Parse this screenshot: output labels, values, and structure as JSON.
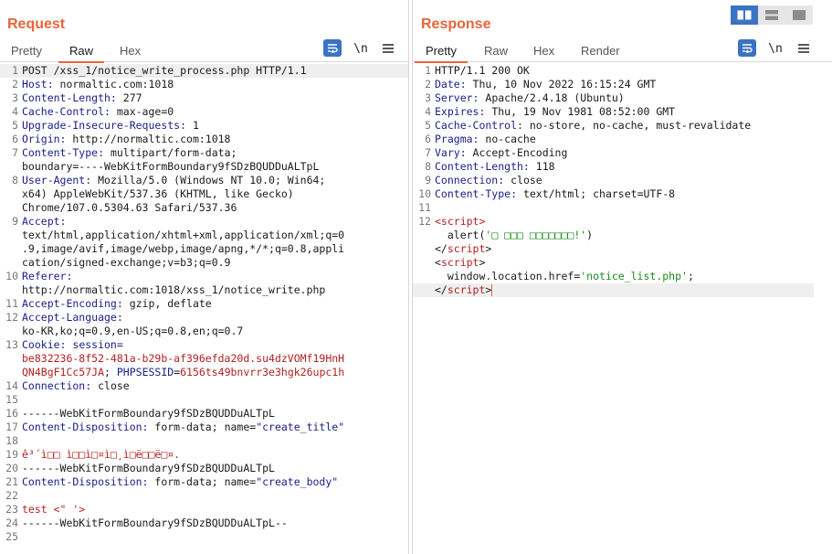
{
  "request": {
    "title": "Request",
    "tabs": [
      "Pretty",
      "Raw",
      "Hex"
    ],
    "active_tab": "Raw",
    "toolbar": {
      "wrap_icon": "wrap-lines-icon",
      "newline_label": "\\n",
      "menu_icon": "hamburger-menu-icon"
    },
    "lines": [
      {
        "n": "1",
        "parts": [
          {
            "t": "POST /xss_1/notice_write_process.php HTTP/1.1"
          }
        ],
        "cur": true
      },
      {
        "n": "2",
        "parts": [
          {
            "t": "Host:",
            "c": "hk"
          },
          {
            "t": " normaltic.com:1018"
          }
        ]
      },
      {
        "n": "3",
        "parts": [
          {
            "t": "Content-Length:",
            "c": "hk"
          },
          {
            "t": " 277"
          }
        ]
      },
      {
        "n": "4",
        "parts": [
          {
            "t": "Cache-Control:",
            "c": "hk"
          },
          {
            "t": " max-age=0"
          }
        ]
      },
      {
        "n": "5",
        "parts": [
          {
            "t": "Upgrade-Insecure-Requests:",
            "c": "hk"
          },
          {
            "t": " 1"
          }
        ]
      },
      {
        "n": "6",
        "parts": [
          {
            "t": "Origin:",
            "c": "hk"
          },
          {
            "t": " http://normaltic.com:1018"
          }
        ]
      },
      {
        "n": "7",
        "parts": [
          {
            "t": "Content-Type:",
            "c": "hk"
          },
          {
            "t": " multipart/form-data;"
          }
        ]
      },
      {
        "n": "",
        "parts": [
          {
            "t": "boundary=----WebKitFormBoundary9fSDzBQUDDuALTpL"
          }
        ]
      },
      {
        "n": "8",
        "parts": [
          {
            "t": "User-Agent:",
            "c": "hk"
          },
          {
            "t": " Mozilla/5.0 (Windows NT 10.0; Win64;"
          }
        ]
      },
      {
        "n": "",
        "parts": [
          {
            "t": "x64) AppleWebKit/537.36 (KHTML, like Gecko)"
          }
        ]
      },
      {
        "n": "",
        "parts": [
          {
            "t": "Chrome/107.0.5304.63 Safari/537.36"
          }
        ]
      },
      {
        "n": "9",
        "parts": [
          {
            "t": "Accept:",
            "c": "hk"
          }
        ]
      },
      {
        "n": "",
        "parts": [
          {
            "t": "text/html,application/xhtml+xml,application/xml;q=0"
          }
        ]
      },
      {
        "n": "",
        "parts": [
          {
            "t": ".9,image/avif,image/webp,image/apng,*/*;q=0.8,appli"
          }
        ]
      },
      {
        "n": "",
        "parts": [
          {
            "t": "cation/signed-exchange;v=b3;q=0.9"
          }
        ]
      },
      {
        "n": "10",
        "parts": [
          {
            "t": "Referer:",
            "c": "hk"
          }
        ]
      },
      {
        "n": "",
        "parts": [
          {
            "t": "http://normaltic.com:1018/xss_1/notice_write.php"
          }
        ]
      },
      {
        "n": "11",
        "parts": [
          {
            "t": "Accept-Encoding:",
            "c": "hk"
          },
          {
            "t": " gzip, deflate"
          }
        ]
      },
      {
        "n": "12",
        "parts": [
          {
            "t": "Accept-Language:",
            "c": "hk"
          }
        ]
      },
      {
        "n": "",
        "parts": [
          {
            "t": "ko-KR,ko;q=0.9,en-US;q=0.8,en;q=0.7"
          }
        ]
      },
      {
        "n": "13",
        "parts": [
          {
            "t": "Cookie:",
            "c": "hk"
          },
          {
            "t": " session=",
            "c": "hk"
          }
        ]
      },
      {
        "n": "",
        "parts": [
          {
            "t": "be832236-8f52-481a-b29b-af396efda20d.su4dzVOMf19HnH",
            "c": "red"
          }
        ]
      },
      {
        "n": "",
        "parts": [
          {
            "t": "QN4BgF1Cc57JA",
            "c": "red"
          },
          {
            "t": "; "
          },
          {
            "t": "PHPSESSID",
            "c": "hk"
          },
          {
            "t": "="
          },
          {
            "t": "6156ts49bnvrr3e3hgk26upc1h",
            "c": "red"
          }
        ]
      },
      {
        "n": "14",
        "parts": [
          {
            "t": "Connection:",
            "c": "hk"
          },
          {
            "t": " close"
          }
        ]
      },
      {
        "n": "15",
        "parts": [
          {
            "t": ""
          }
        ]
      },
      {
        "n": "16",
        "parts": [
          {
            "t": "------WebKitFormBoundary9fSDzBQUDDuALTpL"
          }
        ]
      },
      {
        "n": "17",
        "parts": [
          {
            "t": "Content-Disposition:",
            "c": "hk"
          },
          {
            "t": " form-data; name="
          },
          {
            "t": "\"create_title\"",
            "c": "hk"
          }
        ]
      },
      {
        "n": "18",
        "parts": [
          {
            "t": ""
          }
        ]
      },
      {
        "n": "19",
        "parts": [
          {
            "t": "ê³´ì□□ ì□□ì□¤ì□¸ì□ë□□ë□¤.",
            "c": "red"
          }
        ]
      },
      {
        "n": "20",
        "parts": [
          {
            "t": "------WebKitFormBoundary9fSDzBQUDDuALTpL"
          }
        ]
      },
      {
        "n": "21",
        "parts": [
          {
            "t": "Content-Disposition:",
            "c": "hk"
          },
          {
            "t": " form-data; name="
          },
          {
            "t": "\"create_body\"",
            "c": "hk"
          }
        ]
      },
      {
        "n": "22",
        "parts": [
          {
            "t": ""
          }
        ]
      },
      {
        "n": "23",
        "parts": [
          {
            "t": "test <\" '>",
            "c": "red"
          }
        ]
      },
      {
        "n": "24",
        "parts": [
          {
            "t": "------WebKitFormBoundary9fSDzBQUDDuALTpL--"
          }
        ]
      },
      {
        "n": "25",
        "parts": [
          {
            "t": ""
          }
        ]
      }
    ]
  },
  "response": {
    "title": "Response",
    "tabs": [
      "Pretty",
      "Raw",
      "Hex",
      "Render"
    ],
    "active_tab": "Pretty",
    "toolbar": {
      "wrap_icon": "wrap-lines-icon",
      "newline_label": "\\n",
      "menu_icon": "hamburger-menu-icon"
    },
    "lines": [
      {
        "n": "1",
        "parts": [
          {
            "t": "HTTP/1.1 200 OK"
          }
        ]
      },
      {
        "n": "2",
        "parts": [
          {
            "t": "Date:",
            "c": "hk"
          },
          {
            "t": " Thu, 10 Nov 2022 16:15:24 GMT"
          }
        ]
      },
      {
        "n": "3",
        "parts": [
          {
            "t": "Server:",
            "c": "hk"
          },
          {
            "t": " Apache/2.4.18 (Ubuntu)"
          }
        ]
      },
      {
        "n": "4",
        "parts": [
          {
            "t": "Expires:",
            "c": "hk"
          },
          {
            "t": " Thu, 19 Nov 1981 08:52:00 GMT"
          }
        ]
      },
      {
        "n": "5",
        "parts": [
          {
            "t": "Cache-Control:",
            "c": "hk"
          },
          {
            "t": " no-store, no-cache, must-revalidate"
          }
        ]
      },
      {
        "n": "6",
        "parts": [
          {
            "t": "Pragma:",
            "c": "hk"
          },
          {
            "t": " no-cache"
          }
        ]
      },
      {
        "n": "7",
        "parts": [
          {
            "t": "Vary:",
            "c": "hk"
          },
          {
            "t": " Accept-Encoding"
          }
        ]
      },
      {
        "n": "8",
        "parts": [
          {
            "t": "Content-Length:",
            "c": "hk"
          },
          {
            "t": " 118"
          }
        ]
      },
      {
        "n": "9",
        "parts": [
          {
            "t": "Connection:",
            "c": "hk"
          },
          {
            "t": " close"
          }
        ]
      },
      {
        "n": "10",
        "parts": [
          {
            "t": "Content-Type:",
            "c": "hk"
          },
          {
            "t": " text/html; charset=UTF-8"
          }
        ]
      },
      {
        "n": "11",
        "parts": [
          {
            "t": ""
          }
        ]
      },
      {
        "n": "12",
        "parts": [
          {
            "t": "<script>",
            "c": "tag"
          }
        ]
      },
      {
        "n": "",
        "parts": [
          {
            "t": "  alert("
          },
          {
            "t": "'□ □□□ □□□□□□□!'",
            "c": "str"
          },
          {
            "t": ")"
          }
        ]
      },
      {
        "n": "",
        "parts": [
          {
            "t": "</"
          },
          {
            "t": "script",
            "c": "tag"
          },
          {
            "t": ">"
          }
        ]
      },
      {
        "n": "",
        "parts": [
          {
            "t": "<"
          },
          {
            "t": "script",
            "c": "tag"
          },
          {
            "t": ">"
          }
        ]
      },
      {
        "n": "",
        "parts": [
          {
            "t": "  window.location.href="
          },
          {
            "t": "'notice_list.php'",
            "c": "str"
          },
          {
            "t": ";"
          }
        ]
      },
      {
        "n": "",
        "parts": [
          {
            "t": "</"
          },
          {
            "t": "script",
            "c": "tag"
          },
          {
            "t": ">"
          }
        ],
        "cur": true,
        "caret": true
      }
    ]
  },
  "layout_switch": {
    "buttons": [
      "side-by-side-layout-icon",
      "top-bottom-layout-icon",
      "tabs-layout-icon"
    ],
    "active": 0
  },
  "colors": {
    "accent": "#e8653a",
    "header_key": "#1c1c8a",
    "value_red": "#b22121",
    "string_green": "#1b8a1b",
    "selected_blue": "#3b73c4"
  }
}
